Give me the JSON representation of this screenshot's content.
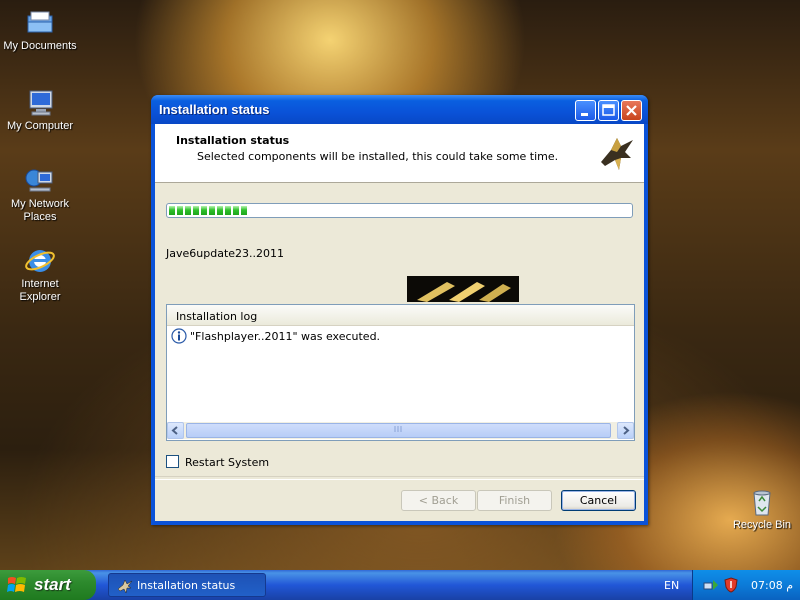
{
  "desktop": {
    "icons": [
      {
        "label": "My Documents",
        "icon": "my-documents-icon"
      },
      {
        "label": "My Computer",
        "icon": "my-computer-icon"
      },
      {
        "label": "My Network\nPlaces",
        "icon": "network-places-icon"
      },
      {
        "label": "Internet\nExplorer",
        "icon": "internet-explorer-icon"
      },
      {
        "label": "Recycle Bin",
        "icon": "recycle-bin-icon"
      }
    ]
  },
  "window": {
    "title": "Installation status",
    "header_title": "Installation status",
    "header_subtitle": "Selected components will be installed, this could take some time.",
    "progress_fraction": 0.18,
    "current_item": "Jave6update23..2011",
    "log": {
      "header": "Installation log",
      "entries": [
        {
          "icon": "info-icon",
          "text": "\"Flashplayer..2011\" was executed."
        }
      ]
    },
    "restart_label": "Restart System",
    "restart_checked": false,
    "buttons": {
      "back": "< Back",
      "finish": "Finish",
      "cancel": "Cancel"
    }
  },
  "taskbar": {
    "start_label": "start",
    "task_label": "Installation status",
    "language": "EN",
    "clock": "07:08 م"
  }
}
